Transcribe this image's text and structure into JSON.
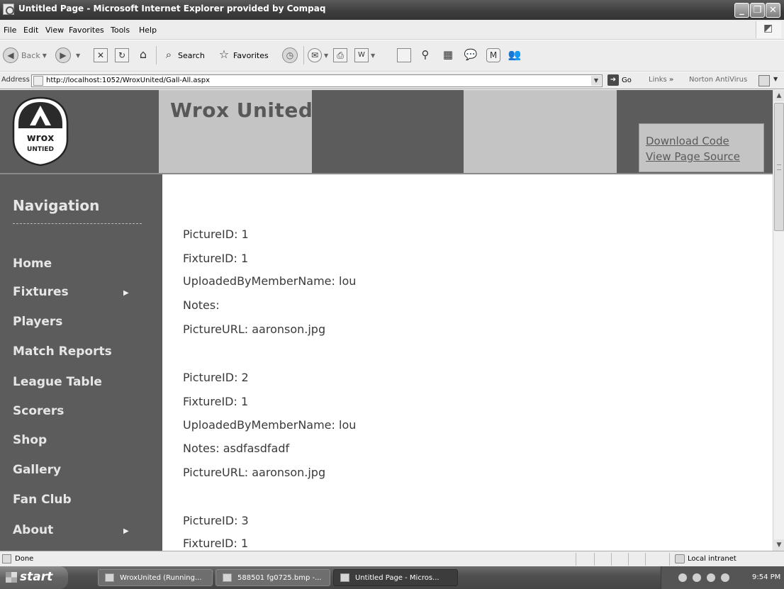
{
  "window": {
    "title": "Untitled Page - Microsoft Internet Explorer provided by Compaq"
  },
  "menu": [
    "File",
    "Edit",
    "View",
    "Favorites",
    "Tools",
    "Help"
  ],
  "toolbar": {
    "back": "Back",
    "search": "Search",
    "favorites": "Favorites"
  },
  "address": {
    "label": "Address",
    "url": "http://localhost:1052/WroxUnited/Gall-All.aspx",
    "go": "Go",
    "links": "Links",
    "norton": "Norton AntiVirus"
  },
  "site": {
    "title": "Wrox United",
    "logo_text": "WROX UNITED",
    "download_code": "Download Code",
    "view_source": "View Page Source"
  },
  "nav": {
    "heading": "Navigation",
    "items": [
      {
        "label": "Home",
        "submenu": false
      },
      {
        "label": "Fixtures",
        "submenu": true
      },
      {
        "label": "Players",
        "submenu": false
      },
      {
        "label": "Match Reports",
        "submenu": false
      },
      {
        "label": "League Table",
        "submenu": false
      },
      {
        "label": "Scorers",
        "submenu": false
      },
      {
        "label": "Shop",
        "submenu": false
      },
      {
        "label": "Gallery",
        "submenu": false
      },
      {
        "label": "Fan Club",
        "submenu": false
      },
      {
        "label": "About",
        "submenu": true
      }
    ]
  },
  "records": [
    {
      "picture_id": "PictureID: 1",
      "fixture_id": "FixtureID: 1",
      "uploaded_by": "UploadedByMemberName: lou",
      "notes": "Notes:",
      "picture_url": "PictureURL: aaronson.jpg"
    },
    {
      "picture_id": "PictureID: 2",
      "fixture_id": "FixtureID: 1",
      "uploaded_by": "UploadedByMemberName: lou",
      "notes": "Notes: asdfasdfadf",
      "picture_url": "PictureURL: aaronson.jpg"
    },
    {
      "picture_id": "PictureID: 3",
      "fixture_id": "FixtureID: 1"
    }
  ],
  "status": {
    "text": "Done",
    "zone": "Local intranet"
  },
  "taskbar": {
    "start": "start",
    "tasks": [
      "WroxUnited (Running...",
      "588501 fg0725.bmp -...",
      "Untitled Page - Micros..."
    ],
    "clock": "9:54 PM"
  }
}
